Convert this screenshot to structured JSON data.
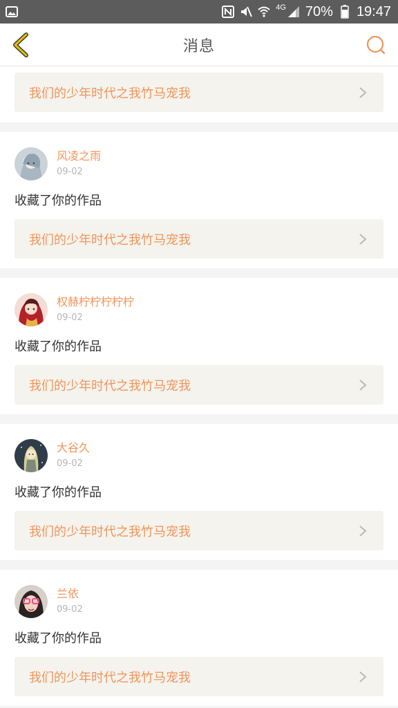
{
  "status_bar": {
    "network": "4G",
    "battery": "70%",
    "time": "19:47"
  },
  "header": {
    "title": "消息",
    "back_icon": "chevron-left-icon",
    "search_icon": "search-icon"
  },
  "colors": {
    "accent": "#f0955a",
    "back_icon": "#e6c000",
    "link_bg": "#f4f3ee"
  },
  "feed": {
    "first_item": {
      "work_title": "我们的少年时代之我竹马宠我"
    },
    "items": [
      {
        "username": "风凌之雨",
        "date": "09-02",
        "action": "收藏了你的作品",
        "work_title": "我们的少年时代之我竹马宠我"
      },
      {
        "username": "权赫柠柠柠柠柠",
        "date": "09-02",
        "action": "收藏了你的作品",
        "work_title": "我们的少年时代之我竹马宠我"
      },
      {
        "username": "大谷久",
        "date": "09-02",
        "action": "收藏了你的作品",
        "work_title": "我们的少年时代之我竹马宠我"
      },
      {
        "username": "兰依",
        "date": "09-02",
        "action": "收藏了你的作品",
        "work_title": "我们的少年时代之我竹马宠我"
      }
    ]
  }
}
